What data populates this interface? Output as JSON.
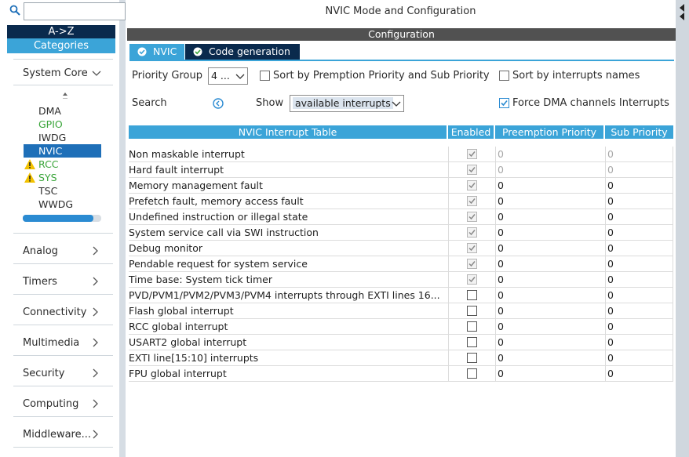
{
  "sidebar": {
    "az_label": "A->Z",
    "categories_label": "Categories",
    "system_core_label": "System Core",
    "system_core_items": [
      {
        "label": "DMA",
        "state": "normal"
      },
      {
        "label": "GPIO",
        "state": "green"
      },
      {
        "label": "IWDG",
        "state": "normal"
      },
      {
        "label": "NVIC",
        "state": "selected"
      },
      {
        "label": "RCC",
        "state": "warning"
      },
      {
        "label": "SYS",
        "state": "warning"
      },
      {
        "label": "TSC",
        "state": "normal"
      },
      {
        "label": "WWDG",
        "state": "normal"
      }
    ],
    "categories": [
      "Analog",
      "Timers",
      "Connectivity",
      "Multimedia",
      "Security",
      "Computing",
      "Middleware..."
    ]
  },
  "main": {
    "title": "NVIC Mode and Configuration",
    "config_label": "Configuration",
    "tabs": [
      {
        "label": "NVIC",
        "active": true
      },
      {
        "label": "Code generation",
        "active": false
      }
    ],
    "priority_group_label": "Priority Group",
    "priority_group_value": "4 ...",
    "sort_premption_label": "Sort by Premption Priority and Sub Priority",
    "sort_interrupts_label": "Sort by interrupts names",
    "search_label": "Search",
    "show_label": "Show",
    "show_value": "available interrupts",
    "force_dma_label": "Force DMA channels Interrupts",
    "force_dma_checked": true
  },
  "table": {
    "headers": [
      "NVIC Interrupt Table",
      "Enabled",
      "Preemption Priority",
      "Sub Priority"
    ],
    "rows": [
      {
        "name": "Non maskable interrupt",
        "enabled": true,
        "locked": true,
        "pre": "0",
        "sub": "0",
        "grey": true
      },
      {
        "name": "Hard fault interrupt",
        "enabled": true,
        "locked": true,
        "pre": "0",
        "sub": "0",
        "grey": true
      },
      {
        "name": "Memory management fault",
        "enabled": true,
        "locked": true,
        "pre": "0",
        "sub": "0",
        "grey": false
      },
      {
        "name": "Prefetch fault, memory access fault",
        "enabled": true,
        "locked": true,
        "pre": "0",
        "sub": "0",
        "grey": false
      },
      {
        "name": "Undefined instruction or illegal state",
        "enabled": true,
        "locked": true,
        "pre": "0",
        "sub": "0",
        "grey": false
      },
      {
        "name": "System service call via SWI instruction",
        "enabled": true,
        "locked": true,
        "pre": "0",
        "sub": "0",
        "grey": false
      },
      {
        "name": "Debug monitor",
        "enabled": true,
        "locked": true,
        "pre": "0",
        "sub": "0",
        "grey": false
      },
      {
        "name": "Pendable request for system service",
        "enabled": true,
        "locked": true,
        "pre": "0",
        "sub": "0",
        "grey": false
      },
      {
        "name": "Time base: System tick timer",
        "enabled": true,
        "locked": true,
        "pre": "0",
        "sub": "0",
        "grey": false
      },
      {
        "name": "PVD/PVM1/PVM2/PVM3/PVM4 interrupts through EXTI lines 16...",
        "enabled": false,
        "locked": false,
        "pre": "0",
        "sub": "0",
        "grey": false
      },
      {
        "name": "Flash global interrupt",
        "enabled": false,
        "locked": false,
        "pre": "0",
        "sub": "0",
        "grey": false
      },
      {
        "name": "RCC global interrupt",
        "enabled": false,
        "locked": false,
        "pre": "0",
        "sub": "0",
        "grey": false
      },
      {
        "name": "USART2 global interrupt",
        "enabled": false,
        "locked": false,
        "pre": "0",
        "sub": "0",
        "grey": false
      },
      {
        "name": "EXTI line[15:10] interrupts",
        "enabled": false,
        "locked": false,
        "pre": "0",
        "sub": "0",
        "grey": false
      },
      {
        "name": "FPU global interrupt",
        "enabled": false,
        "locked": false,
        "pre": "0",
        "sub": "0",
        "grey": false
      }
    ]
  },
  "colors": {
    "accent": "#3ba4d8",
    "navy": "#0a2a4d",
    "selected": "#1e6fb8",
    "green": "#3aa53a",
    "warning": "#f2c200"
  }
}
